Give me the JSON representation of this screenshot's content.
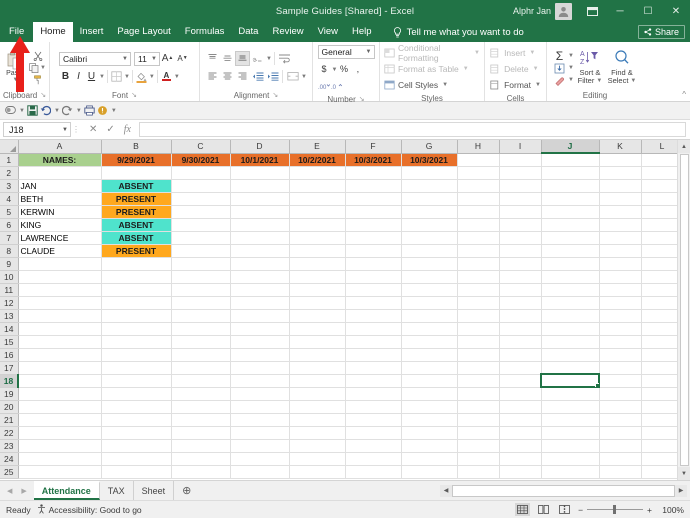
{
  "titlebar": {
    "document_title": "Sample Guides  [Shared]  -  Excel",
    "user_name": "Alphr Jan",
    "avatar_icon": "user-avatar-icon",
    "ribbon_display_icon": "ribbon-display-options-icon",
    "minimize_label": "─",
    "maximize_label": "☐",
    "close_label": "✕"
  },
  "tabs": {
    "items": [
      {
        "label": "File"
      },
      {
        "label": "Home"
      },
      {
        "label": "Insert"
      },
      {
        "label": "Page Layout"
      },
      {
        "label": "Formulas"
      },
      {
        "label": "Data"
      },
      {
        "label": "Review"
      },
      {
        "label": "View"
      },
      {
        "label": "Help"
      }
    ],
    "active": "Home",
    "tellme_placeholder": "Tell me what you want to do",
    "tellme_icon": "lightbulb-icon",
    "share_label": "Share",
    "share_icon": "share-icon"
  },
  "ribbon": {
    "clipboard": {
      "label": "Clipboard",
      "paste_label": "Paste",
      "cut_icon": "scissors-icon",
      "copy_icon": "copy-icon",
      "format_painter_icon": "format-painter-icon",
      "dialog_launcher": "↘"
    },
    "font": {
      "label": "Font",
      "font_name": "Calibri",
      "font_size": "11",
      "grow_font_label": "A",
      "shrink_font_label": "A",
      "bold_label": "B",
      "italic_label": "I",
      "underline_label": "U",
      "borders_icon": "borders-icon",
      "fill_color_icon": "fill-color-icon",
      "font_color_label": "A",
      "dialog_launcher": "↘"
    },
    "alignment": {
      "label": "Alignment",
      "top_align_icon": "align-top-icon",
      "middle_align_icon": "align-middle-icon",
      "bottom_align_icon": "align-bottom-icon",
      "orientation_icon": "orientation-icon",
      "wrap_text_icon": "wrap-text-icon",
      "align_left_icon": "align-left-icon",
      "align_center_icon": "align-center-icon",
      "align_right_icon": "align-right-icon",
      "decrease_indent_icon": "decrease-indent-icon",
      "increase_indent_icon": "increase-indent-icon",
      "merge_center_icon": "merge-and-center-icon",
      "dialog_launcher": "↘"
    },
    "number": {
      "label": "Number",
      "format_value": "General",
      "currency_label": "$",
      "percent_label": "%",
      "comma_label": " ,",
      "increase_decimal_icon": "increase-decimal-icon",
      "decrease_decimal_icon": "decrease-decimal-icon",
      "dialog_launcher": "↘"
    },
    "styles": {
      "label": "Styles",
      "conditional_formatting_label": "Conditional Formatting",
      "format_as_table_label": "Format as Table",
      "cell_styles_label": "Cell Styles"
    },
    "cells": {
      "label": "Cells",
      "insert_label": "Insert",
      "delete_label": "Delete",
      "format_label": "Format"
    },
    "editing": {
      "label": "Editing",
      "autosum_label": "Σ",
      "fill_icon": "fill-down-icon",
      "clear_icon": "clear-eraser-icon",
      "sort_filter_line1": "Sort &",
      "sort_filter_line2": "Filter",
      "sort_filter_icon": "sort-filter-icon",
      "find_select_line1": "Find &",
      "find_select_line2": "Select",
      "find_select_icon": "magnifier-icon"
    },
    "collapse_icon": "collapse-ribbon-icon"
  },
  "qat": {
    "autosave_icon": "autosave-icon",
    "save_icon": "save-icon",
    "undo_icon": "undo-icon",
    "redo_icon": "redo-icon",
    "print_icon": "print-preview-icon",
    "touch_icon": "touch-mode-icon",
    "customize_icon": "customize-qat-icon"
  },
  "formula_bar": {
    "name_box_value": "J18",
    "cancel_icon": "cancel-icon",
    "enter_icon": "enter-checkmark-icon",
    "function_icon": "insert-function-icon",
    "formula_value": ""
  },
  "sheet": {
    "columns": [
      "A",
      "B",
      "C",
      "D",
      "E",
      "F",
      "G",
      "H",
      "I",
      "J",
      "K",
      "L"
    ],
    "selected_column": "J",
    "selected_row": 18,
    "selected_cell": "J18",
    "rows": [
      1,
      2,
      3,
      4,
      5,
      6,
      7,
      8,
      9,
      10,
      11,
      12,
      13,
      14,
      15,
      16,
      17,
      18,
      19,
      20,
      21,
      22,
      23,
      24,
      25
    ],
    "data": [
      {
        "row": 1,
        "cells": [
          {
            "col": "A",
            "value": "NAMES:",
            "style": "names"
          },
          {
            "col": "B",
            "value": "9/29/2021",
            "style": "date"
          },
          {
            "col": "C",
            "value": "9/30/2021",
            "style": "date"
          },
          {
            "col": "D",
            "value": "10/1/2021",
            "style": "date"
          },
          {
            "col": "E",
            "value": "10/2/2021",
            "style": "date"
          },
          {
            "col": "F",
            "value": "10/3/2021",
            "style": "date"
          },
          {
            "col": "G",
            "value": "10/3/2021",
            "style": "date"
          }
        ]
      },
      {
        "row": 3,
        "cells": [
          {
            "col": "A",
            "value": "JAN",
            "style": "namecell"
          },
          {
            "col": "B",
            "value": "ABSENT",
            "style": "absent"
          }
        ]
      },
      {
        "row": 4,
        "cells": [
          {
            "col": "A",
            "value": "BETH",
            "style": "namecell"
          },
          {
            "col": "B",
            "value": "PRESENT",
            "style": "present"
          }
        ]
      },
      {
        "row": 5,
        "cells": [
          {
            "col": "A",
            "value": "KERWIN",
            "style": "namecell"
          },
          {
            "col": "B",
            "value": "PRESENT",
            "style": "present"
          }
        ]
      },
      {
        "row": 6,
        "cells": [
          {
            "col": "A",
            "value": "KING",
            "style": "namecell"
          },
          {
            "col": "B",
            "value": "ABSENT",
            "style": "absent"
          }
        ]
      },
      {
        "row": 7,
        "cells": [
          {
            "col": "A",
            "value": "LAWRENCE",
            "style": "namecell"
          },
          {
            "col": "B",
            "value": "ABSENT",
            "style": "absent"
          }
        ]
      },
      {
        "row": 8,
        "cells": [
          {
            "col": "A",
            "value": "CLAUDE",
            "style": "namecell"
          },
          {
            "col": "B",
            "value": "PRESENT",
            "style": "present"
          }
        ]
      }
    ]
  },
  "sheet_tabs": {
    "items": [
      {
        "label": "Attendance",
        "active": true
      },
      {
        "label": "TAX",
        "active": false
      },
      {
        "label": "Sheet",
        "active": false
      }
    ],
    "add_sheet_icon": "add-sheet-icon",
    "prev_icon": "previous-sheet-icon",
    "next_icon": "next-sheet-icon"
  },
  "status_bar": {
    "state": "Ready",
    "accessibility": "Accessibility: Good to go",
    "accessibility_icon": "accessibility-icon",
    "normal_view_icon": "normal-view-icon",
    "page_layout_icon": "page-layout-view-icon",
    "page_break_icon": "page-break-view-icon",
    "zoom_out_label": "−",
    "zoom_in_label": "+",
    "zoom_level": "100%"
  },
  "annotation": {
    "arrow_color": "#e8201a",
    "points_to": "File"
  },
  "colors": {
    "excel_green": "#217346",
    "names_header": "#a9d08e",
    "date_header": "#e8702a",
    "absent": "#4fe3cc",
    "present": "#ffa81e"
  }
}
